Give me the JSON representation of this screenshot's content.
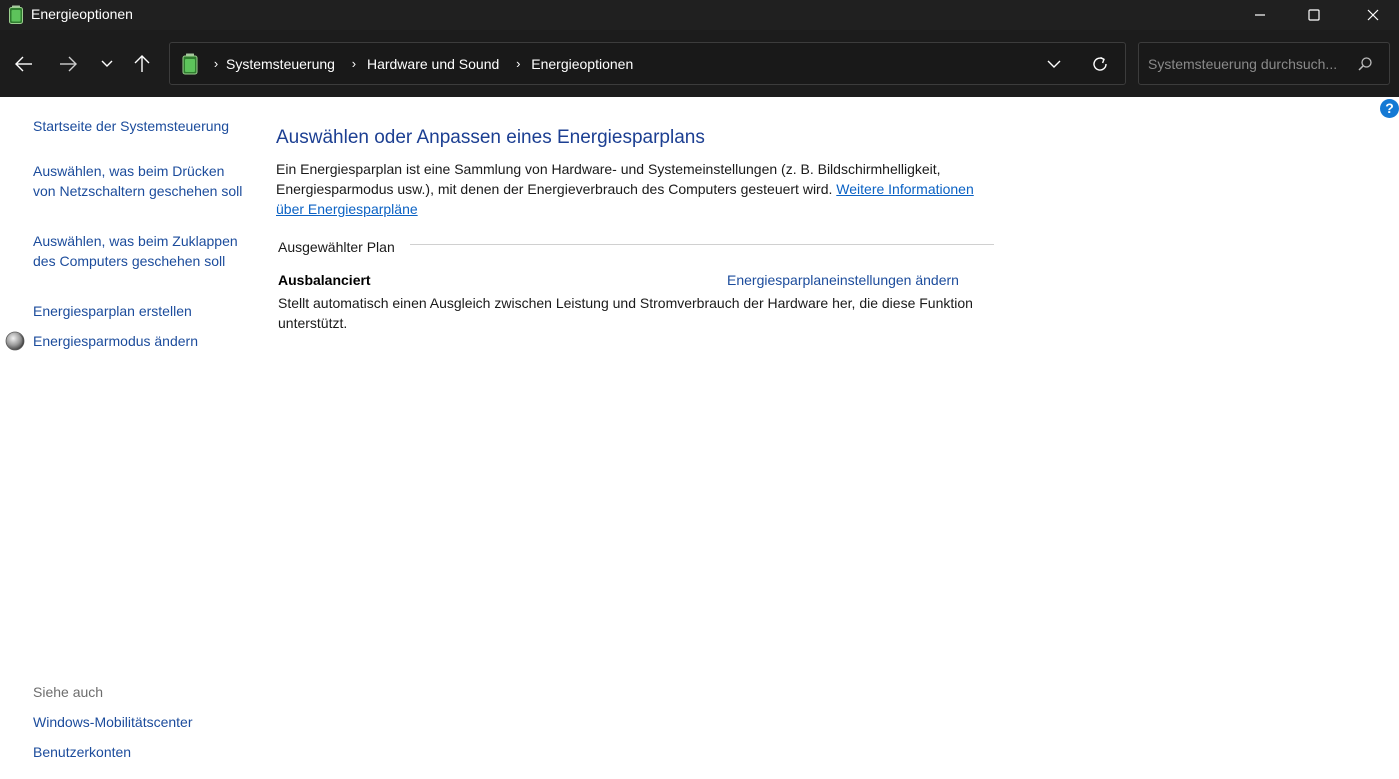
{
  "window": {
    "title": "Energieoptionen"
  },
  "breadcrumb": {
    "items": [
      "Systemsteuerung",
      "Hardware und Sound",
      "Energieoptionen"
    ]
  },
  "search": {
    "placeholder": "Systemsteuerung durchsuch..."
  },
  "help": {
    "label": "?"
  },
  "sidebar": {
    "home": "Startseite der Systemsteuerung",
    "links": [
      "Auswählen, was beim Drücken von Netzschaltern geschehen soll",
      "Auswählen, was beim Zuklappen des Computers geschehen soll",
      "Energiesparplan erstellen",
      "Energiesparmodus ändern"
    ],
    "see_also": {
      "heading": "Siehe auch",
      "links": [
        "Windows-Mobilitätscenter",
        "Benutzerkonten"
      ]
    }
  },
  "main": {
    "title": "Auswählen oder Anpassen eines Energiesparplans",
    "intro": "Ein Energiesparplan ist eine Sammlung von Hardware- und Systemeinstellungen (z. B. Bildschirmhelligkeit, Energiesparmodus usw.), mit denen der Energieverbrauch des Computers gesteuert wird. ",
    "intro_link": "Weitere Informationen über Energiesparpläne",
    "selected_plan_label": "Ausgewählter Plan",
    "plan": {
      "name": "Ausbalanciert",
      "settings_link": "Energiesparplaneinstellungen ändern",
      "description": "Stellt automatisch einen Ausgleich zwischen Leistung und Stromverbrauch der Hardware her, die diese Funktion unterstützt."
    }
  },
  "colors": {
    "titlebar": "#202020",
    "navbar": "#1c1c1c",
    "link": "#1c4c9c",
    "heading": "#1c3f92",
    "help": "#1479d4"
  }
}
